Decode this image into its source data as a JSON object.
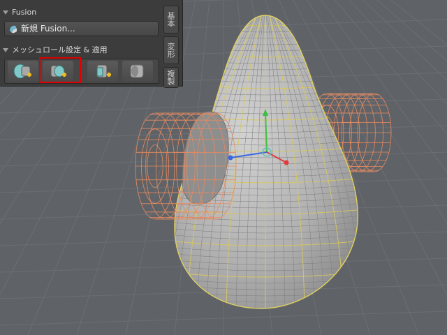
{
  "panel": {
    "fusion_header": "Fusion",
    "new_fusion_label": "新規 Fusion...",
    "meshroll_header": "メッシュロール設定 & 適用",
    "tool_icons": [
      "union-fusion-icon",
      "subtract-fusion-icon",
      "intersect-fusion-icon",
      "remove-fusion-icon"
    ]
  },
  "tabs": [
    "基本",
    "変形",
    "複製"
  ],
  "colors": {
    "panel_bg": "#3c3c3c",
    "viewport_bg": "#5f6367",
    "mesh_surface": "#b8b8b8",
    "selection_wire": "#e0d060",
    "cylinder_wire": "#e88a60",
    "highlight": "#e00000",
    "axis_x": "#e03a3a",
    "axis_y": "#3fbf3f",
    "axis_z": "#3a66e0"
  }
}
